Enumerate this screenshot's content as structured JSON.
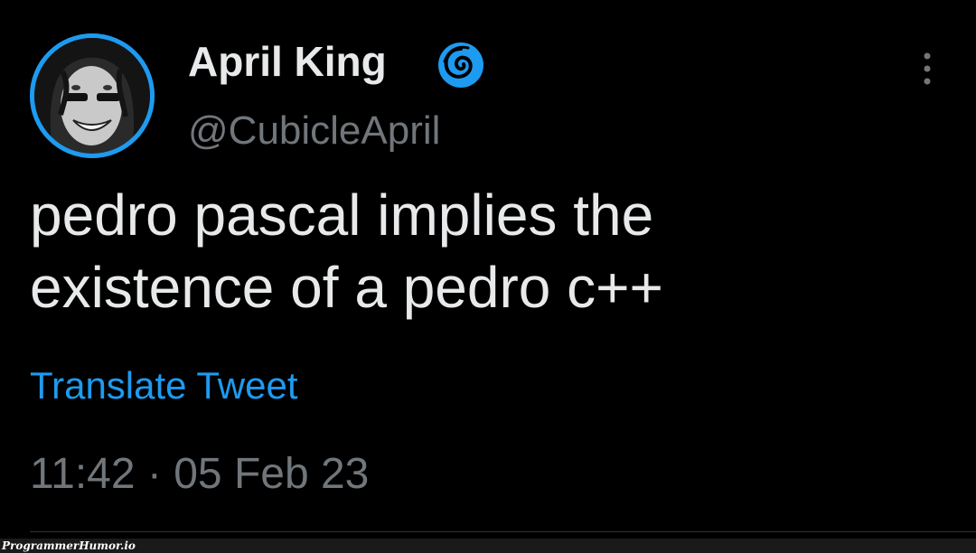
{
  "author": {
    "display_name": "April King",
    "handle": "@CubicleApril",
    "avatar_icon": "profile-photo",
    "badge_icon": "spiral-badge-icon"
  },
  "tweet": {
    "text_lines": [
      "pedro pascal implies the",
      "existence of a pedro c++"
    ],
    "translate_label": "Translate Tweet",
    "timestamp": "11:42 · 05 Feb 23"
  },
  "watermark": "ProgrammerHumor.io",
  "colors": {
    "background": "#000000",
    "primary_text": "#e7e9ea",
    "secondary_text": "#71767b",
    "accent": "#1d9bf0"
  }
}
